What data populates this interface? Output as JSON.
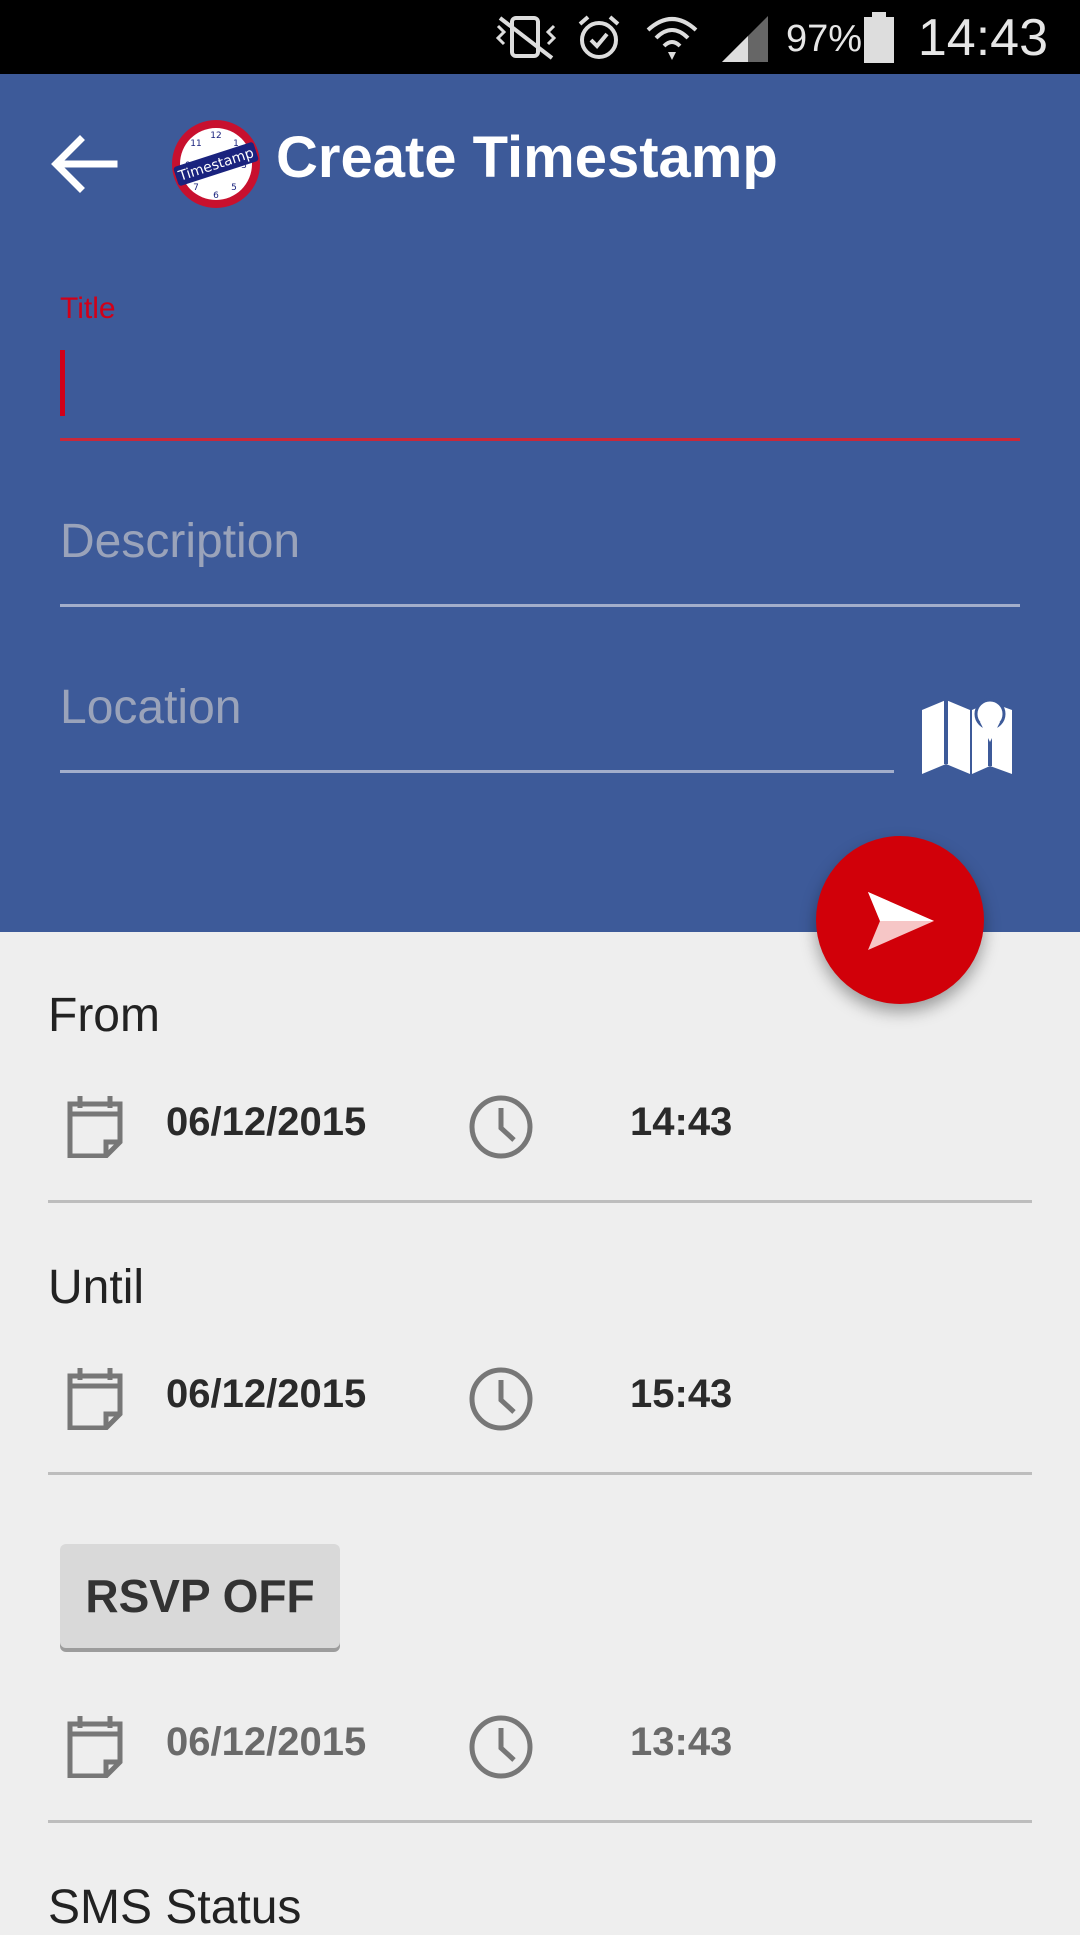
{
  "status_bar": {
    "battery_percent": "97%",
    "time": "14:43",
    "icons": [
      "mute-vibrate-icon",
      "alarm-icon",
      "wifi-icon",
      "signal-icon",
      "battery-icon"
    ]
  },
  "toolbar": {
    "title": "Create Timestamp",
    "back_icon": "arrow-back-icon",
    "logo_text": "Timestamp"
  },
  "form": {
    "title_label": "Title",
    "title_value": "",
    "description_placeholder": "Description",
    "location_placeholder": "Location",
    "map_icon": "map-pin-icon",
    "send_icon": "send-icon"
  },
  "from": {
    "label": "From",
    "date": "06/12/2015",
    "time": "14:43"
  },
  "until": {
    "label": "Until",
    "date": "06/12/2015",
    "time": "15:43"
  },
  "rsvp": {
    "button_label": "RSVP OFF",
    "date": "06/12/2015",
    "time": "13:43"
  },
  "sms": {
    "label": "SMS Status"
  },
  "colors": {
    "primary": "#3d5a99",
    "accent": "#d10009",
    "background": "#eeeeee"
  }
}
